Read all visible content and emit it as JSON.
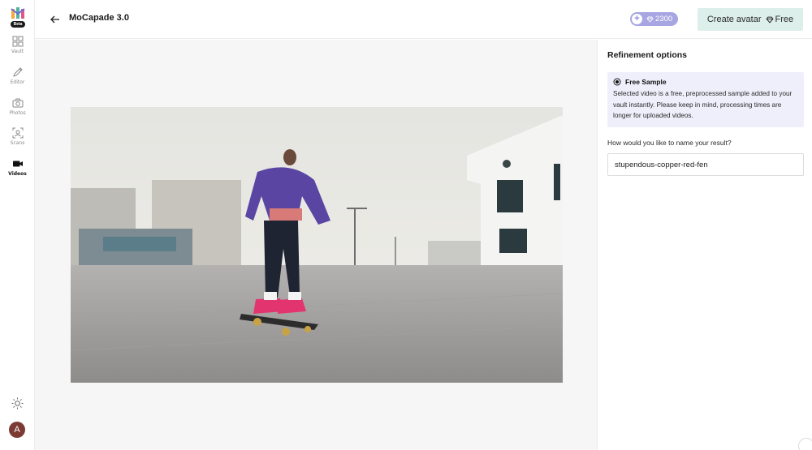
{
  "sidebar": {
    "logo_badge": "Beta",
    "items": [
      {
        "label": "Vault",
        "icon": "grid-icon"
      },
      {
        "label": "Editor",
        "icon": "pencil-icon"
      },
      {
        "label": "Photos",
        "icon": "camera-icon"
      },
      {
        "label": "Scans",
        "icon": "scan-icon"
      },
      {
        "label": "Videos",
        "icon": "video-icon",
        "active": true
      }
    ],
    "avatar_initial": "A"
  },
  "header": {
    "title": "MoCapade 3.0",
    "credits": "2300",
    "create_label": "Create avatar",
    "free_label": "Free"
  },
  "panel": {
    "title": "Refinement options",
    "info_title": "Free Sample",
    "info_text": "Selected video is a free, preprocessed sample added to your vault instantly. Please keep in mind, processing times are longer for uploaded videos.",
    "name_label": "How would you like to name your result?",
    "name_value": "stupendous-copper-red-fen"
  },
  "colors": {
    "accent_purple": "#a7a6e2",
    "create_button_bg": "#dcefea",
    "info_bg": "#efeffb",
    "avatar_bg": "#7b3b34"
  }
}
